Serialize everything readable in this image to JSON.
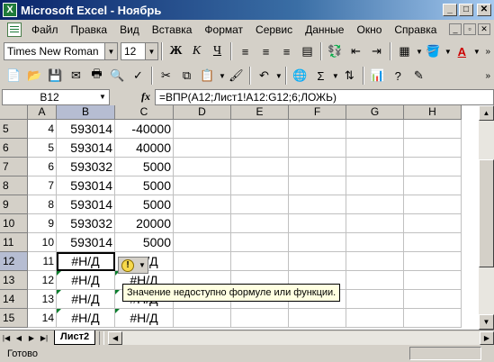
{
  "window": {
    "title": "Microsoft Excel - Ноябрь",
    "app_icon": "X"
  },
  "menu": {
    "items": [
      "Файл",
      "Правка",
      "Вид",
      "Вставка",
      "Формат",
      "Сервис",
      "Данные",
      "Окно",
      "Справка"
    ]
  },
  "format_toolbar": {
    "font": "Times New Roman",
    "size": "12",
    "bold": "Ж",
    "italic": "К",
    "underline": "Ч",
    "font_color_label": "A"
  },
  "standard_toolbar": {
    "sigma": "Σ"
  },
  "formula_bar": {
    "name_box": "B12",
    "fx": "fx",
    "formula": "=ВПР(A12;Лист1!A12:G12;6;ЛОЖЬ)"
  },
  "grid": {
    "columns": [
      "A",
      "B",
      "C",
      "D",
      "E",
      "F",
      "G",
      "H"
    ],
    "active_column": "B",
    "active_row": "12",
    "rows": [
      {
        "num": "5",
        "a": "4",
        "b": "593014",
        "c": "-40000"
      },
      {
        "num": "6",
        "a": "5",
        "b": "593014",
        "c": "40000"
      },
      {
        "num": "7",
        "a": "6",
        "b": "593032",
        "c": "5000"
      },
      {
        "num": "8",
        "a": "7",
        "b": "593014",
        "c": "5000"
      },
      {
        "num": "9",
        "a": "8",
        "b": "593014",
        "c": "5000"
      },
      {
        "num": "10",
        "a": "9",
        "b": "593032",
        "c": "20000"
      },
      {
        "num": "11",
        "a": "10",
        "b": "593014",
        "c": "5000"
      },
      {
        "num": "12",
        "a": "11",
        "b": "#Н/Д",
        "c": "#Н/Д"
      },
      {
        "num": "13",
        "a": "12",
        "b": "#Н/Д",
        "c": "#Н/Д"
      },
      {
        "num": "14",
        "a": "13",
        "b": "#Н/Д",
        "c": "#Н/Д"
      },
      {
        "num": "15",
        "a": "14",
        "b": "#Н/Д",
        "c": "#Н/Д"
      }
    ]
  },
  "smart_tag": {
    "icon": "!",
    "tooltip": "Значение недоступно формуле или функции."
  },
  "sheet_tabs": {
    "active": "Лист2"
  },
  "status": {
    "text": "Готово"
  },
  "colors": {
    "error_triangle": "#0a7d2c",
    "title_bar": "#0a246a",
    "tooltip_bg": "#ffffe1"
  }
}
